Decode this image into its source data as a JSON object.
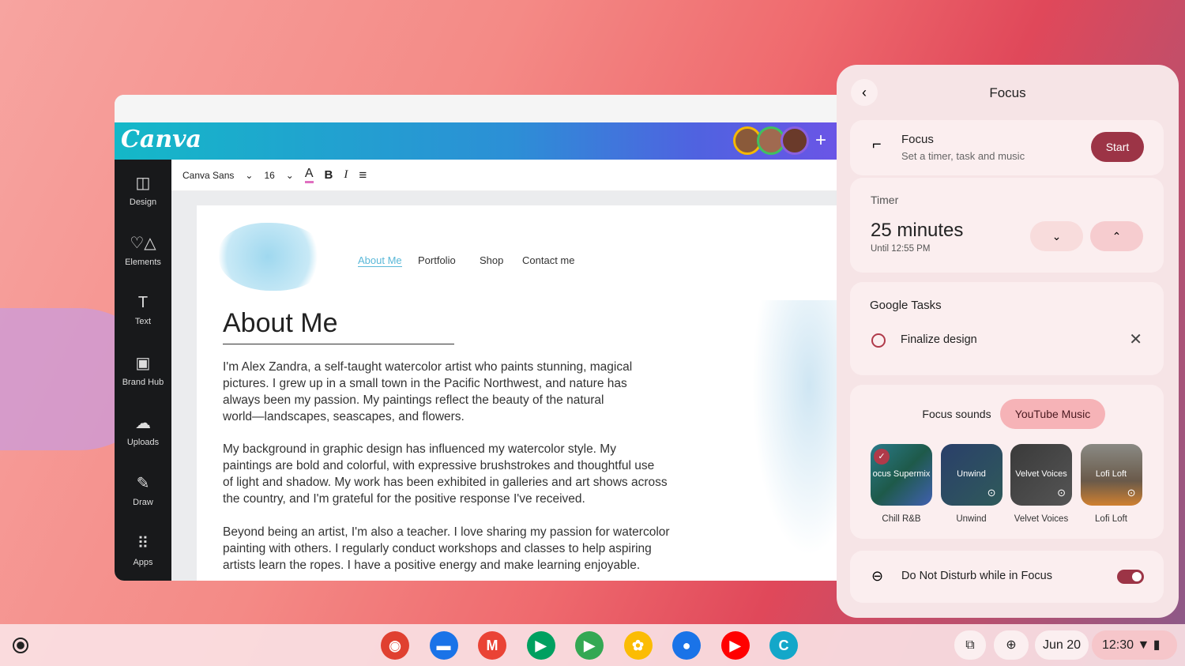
{
  "canva": {
    "logo": "Canva",
    "sidebar": [
      {
        "label": "Design",
        "icon": "◫"
      },
      {
        "label": "Elements",
        "icon": "♡△"
      },
      {
        "label": "Text",
        "icon": "T"
      },
      {
        "label": "Brand Hub",
        "icon": "▣"
      },
      {
        "label": "Uploads",
        "icon": "☁"
      },
      {
        "label": "Draw",
        "icon": "✎"
      },
      {
        "label": "Apps",
        "icon": "⠿"
      }
    ],
    "toolbar": {
      "font": "Canva Sans",
      "size": "16",
      "color_glyph": "A",
      "bold": "B",
      "italic": "I",
      "align": "≡"
    },
    "page": {
      "nav": [
        "About Me",
        "Portfolio",
        "Shop",
        "Contact me"
      ],
      "heading": "About Me",
      "paragraphs": [
        [
          "I'm Alex Zandra, a self-taught watercolor artist who paints stunning, magical",
          "pictures. I grew up in a small town in the Pacific Northwest, and nature has",
          "always been my passion. My paintings reflect the beauty of the natural",
          "world—landscapes, seascapes, and flowers."
        ],
        [
          "My background in graphic design has influenced my watercolor style. My",
          "paintings are bold and colorful, with expressive brushstrokes and thoughtful use",
          "of light and shadow. My work has been exhibited in galleries and art shows across",
          "the country, and I'm grateful for the positive response I've received."
        ],
        [
          "Beyond being an artist, I'm also a teacher. I love sharing my passion for watercolor",
          "painting with others. I regularly conduct workshops and classes to help aspiring",
          "artists learn the ropes. I have a positive energy and make learning enjoyable."
        ]
      ]
    }
  },
  "focus": {
    "title": "Focus",
    "card_title": "Focus",
    "card_sub": "Set a timer, task and music",
    "start": "Start",
    "timer_label": "Timer",
    "timer_value": "25 minutes",
    "until": "Until 12:55 PM",
    "tasks_label": "Google Tasks",
    "task": "Finalize design",
    "tabs": [
      "Focus sounds",
      "YouTube Music"
    ],
    "tiles": [
      {
        "overlay": "ocus Supermix",
        "label": "Chill R&B",
        "bg": "linear-gradient(135deg,#2a7a8a,#1e5a4a 50%,#4060b0)"
      },
      {
        "overlay": "Unwind",
        "label": "Unwind",
        "bg": "linear-gradient(135deg,#2a3f6a,#2f5a5a)"
      },
      {
        "overlay": "Velvet Voices",
        "label": "Velvet Voices",
        "bg": "linear-gradient(135deg,#3a3a3a,#555)"
      },
      {
        "overlay": "Lofi Loft",
        "label": "Lofi Loft",
        "bg": "linear-gradient(180deg,#8a8a84,#6a5a4a 60%,#d08030)"
      }
    ],
    "dnd": "Do Not Disturb while in Focus",
    "dnd_on": true
  },
  "shelf": {
    "apps": [
      {
        "name": "chrome",
        "g": "◉",
        "c": "#e04030"
      },
      {
        "name": "files",
        "g": "▬",
        "c": "#1a73e8"
      },
      {
        "name": "gmail",
        "g": "M",
        "c": "#ea4335"
      },
      {
        "name": "meet",
        "g": "▶",
        "c": "#00a060"
      },
      {
        "name": "play",
        "g": "▶",
        "c": "#34a853"
      },
      {
        "name": "photos",
        "g": "✿",
        "c": "#fbbc04"
      },
      {
        "name": "messages",
        "g": "●",
        "c": "#1a73e8"
      },
      {
        "name": "youtube",
        "g": "▶",
        "c": "#ff0000"
      },
      {
        "name": "canva",
        "g": "C",
        "c": "#13a7c9"
      }
    ],
    "date": "Jun 20",
    "time": "12:30"
  }
}
